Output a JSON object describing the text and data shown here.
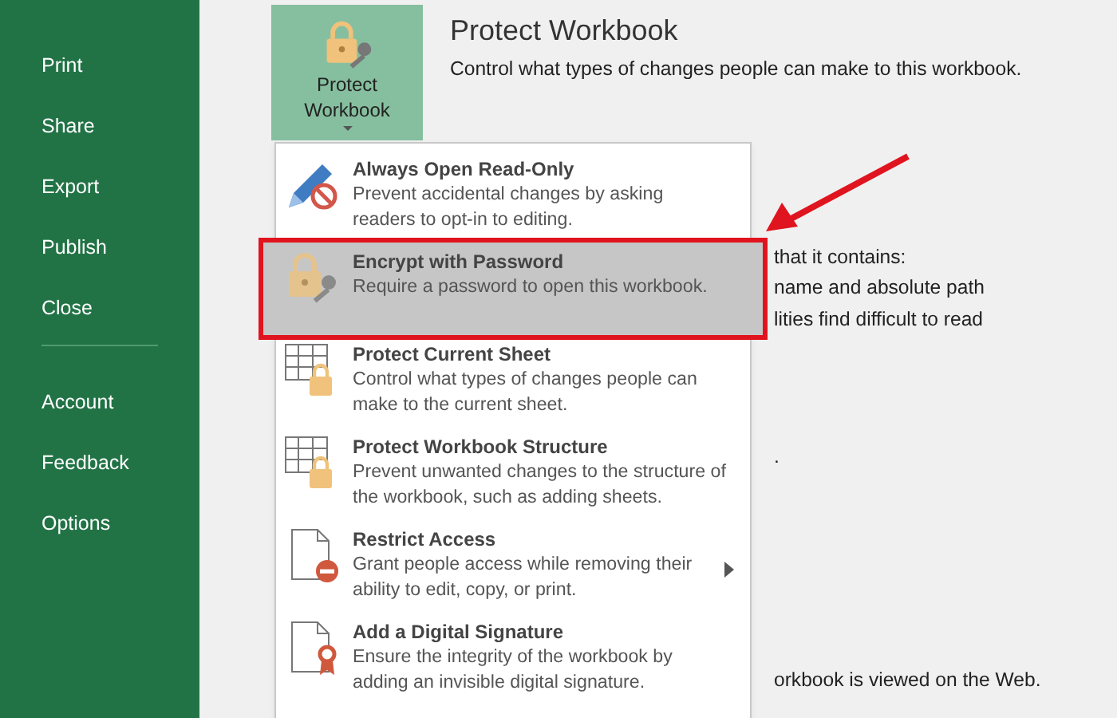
{
  "sidebar": {
    "groups": [
      [
        {
          "label": "Print"
        },
        {
          "label": "Share"
        },
        {
          "label": "Export"
        },
        {
          "label": "Publish"
        },
        {
          "label": "Close"
        }
      ],
      [
        {
          "label": "Account"
        },
        {
          "label": "Feedback"
        },
        {
          "label": "Options"
        }
      ]
    ]
  },
  "protect_button": {
    "label": "Protect Workbook",
    "expanded": true
  },
  "section": {
    "title": "Protect Workbook",
    "description": "Control what types of changes people can make to this workbook."
  },
  "background_text": [
    "that it contains:",
    "name and absolute path",
    "lities find difficult to read",
    ".",
    "orkbook is viewed on the Web."
  ],
  "menu": [
    {
      "kind": "pencil",
      "title": "Always Open Read-Only",
      "description": "Prevent accidental changes by asking readers to opt-in to editing.",
      "selected": false,
      "highlighted": false,
      "submenu": false
    },
    {
      "kind": "lock",
      "title": "Encrypt with Password",
      "description": "Require a password to open this workbook.",
      "selected": true,
      "highlighted": true,
      "submenu": false
    },
    {
      "kind": "sheet",
      "title": "Protect Current Sheet",
      "description": "Control what types of changes people can make to the current sheet.",
      "selected": false,
      "highlighted": false,
      "submenu": false
    },
    {
      "kind": "sheet",
      "title": "Protect Workbook Structure",
      "description": "Prevent unwanted changes to the structure of the workbook, such as adding sheets.",
      "selected": false,
      "highlighted": false,
      "submenu": false
    },
    {
      "kind": "restrict",
      "title": "Restrict Access",
      "description": "Grant people access while removing their ability to edit, copy, or print.",
      "selected": false,
      "highlighted": false,
      "submenu": true
    },
    {
      "kind": "signature",
      "title": "Add a Digital Signature",
      "description": "Ensure the integrity of the workbook by adding an invisible digital signature.",
      "selected": false,
      "highlighted": false,
      "submenu": false
    }
  ]
}
